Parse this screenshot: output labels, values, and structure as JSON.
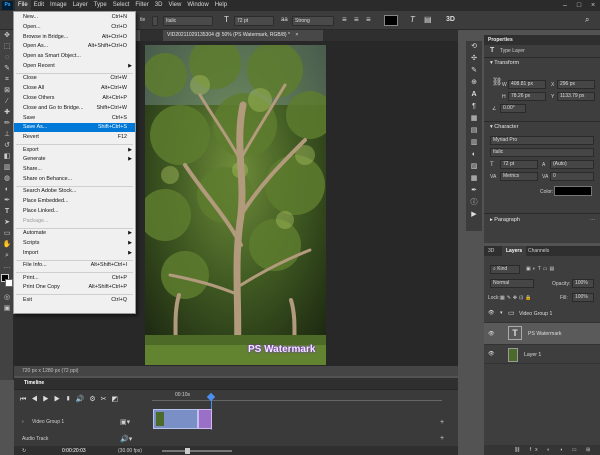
{
  "menubar": {
    "logo": "Ps",
    "items": [
      "File",
      "Edit",
      "Image",
      "Layer",
      "Type",
      "Select",
      "Filter",
      "3D",
      "View",
      "Window",
      "Help"
    ],
    "window_controls": [
      "–",
      "□",
      "×"
    ]
  },
  "options": {
    "font_style": "Italic",
    "font_size": "72 pt",
    "anti_alias": "Strong",
    "prefix": "tle"
  },
  "document": {
    "tab_title": "VID20211029135304 @ 50% (PS Watermark, RGB/8) *",
    "watermark_text": "PS Watermark",
    "status": "720 px x 1280 px (72 ppi)"
  },
  "file_menu": {
    "items": [
      {
        "label": "New...",
        "shortcut": "Ctrl+N"
      },
      {
        "label": "Open...",
        "shortcut": "Ctrl+O"
      },
      {
        "label": "Browse in Bridge...",
        "shortcut": "Alt+Ctrl+O"
      },
      {
        "label": "Open As...",
        "shortcut": "Alt+Shift+Ctrl+O"
      },
      {
        "label": "Open as Smart Object...",
        "shortcut": ""
      },
      {
        "label": "Open Recent",
        "shortcut": "",
        "submenu": true
      },
      {
        "label": "Close",
        "shortcut": "Ctrl+W"
      },
      {
        "label": "Close All",
        "shortcut": "Alt+Ctrl+W"
      },
      {
        "label": "Close Others",
        "shortcut": "Alt+Ctrl+P"
      },
      {
        "label": "Close and Go to Bridge...",
        "shortcut": "Shift+Ctrl+W"
      },
      {
        "label": "Save",
        "shortcut": "Ctrl+S"
      },
      {
        "label": "Save As...",
        "shortcut": "Shift+Ctrl+S",
        "highlighted": true
      },
      {
        "label": "Revert",
        "shortcut": "F12"
      },
      {
        "label": "Export",
        "shortcut": "",
        "submenu": true
      },
      {
        "label": "Generate",
        "shortcut": "",
        "submenu": true
      },
      {
        "label": "Share...",
        "shortcut": ""
      },
      {
        "label": "Share on Behance...",
        "shortcut": ""
      },
      {
        "label": "Search Adobe Stock...",
        "shortcut": ""
      },
      {
        "label": "Place Embedded...",
        "shortcut": ""
      },
      {
        "label": "Place Linked...",
        "shortcut": ""
      },
      {
        "label": "Package...",
        "shortcut": "",
        "disabled": true
      },
      {
        "label": "Automate",
        "shortcut": "",
        "submenu": true
      },
      {
        "label": "Scripts",
        "shortcut": "",
        "submenu": true
      },
      {
        "label": "Import",
        "shortcut": "",
        "submenu": true
      },
      {
        "label": "File Info...",
        "shortcut": "Alt+Shift+Ctrl+I"
      },
      {
        "label": "Print...",
        "shortcut": "Ctrl+P"
      },
      {
        "label": "Print One Copy",
        "shortcut": "Alt+Shift+Ctrl+P"
      },
      {
        "label": "Exit",
        "shortcut": "Ctrl+Q"
      }
    ]
  },
  "properties": {
    "title": "Properties",
    "layer_type": "Type Layer",
    "transform_label": "Transform",
    "w": "408.81 px",
    "h": "78.26 px",
    "x": "296 px",
    "y": "1133.79 px",
    "angle": "0.00°",
    "character_label": "Character",
    "font_family": "Myriad Pro",
    "font_style": "Italic",
    "font_size": "72 pt",
    "leading": "(Auto)",
    "kerning": "Metrics",
    "tracking": "0",
    "color_label": "Color:",
    "paragraph_label": "Paragraph",
    "w_label": "W",
    "h_label": "H",
    "x_label": "X",
    "y_label": "Y"
  },
  "layers": {
    "tabs": [
      "3D",
      "Layers",
      "Channels"
    ],
    "kind": "Kind",
    "blend": "Normal",
    "opacity_label": "Opacity:",
    "opacity": "100%",
    "lock_label": "Lock:",
    "fill_label": "Fill:",
    "fill": "100%",
    "rows": [
      {
        "name": "Video Group 1",
        "type": "group"
      },
      {
        "name": "PS Watermark",
        "type": "text"
      },
      {
        "name": "Layer 1",
        "type": "video"
      }
    ]
  },
  "timeline": {
    "title": "Timeline",
    "time_mark": "00:10s",
    "track1": "Video Group 1",
    "track2": "Audio Track",
    "timecode": "0:00:20:03",
    "fps": "(30.00 fps)"
  },
  "colors": {
    "accent": "#0078d7",
    "watermark_glow": "#7c2bd6"
  }
}
